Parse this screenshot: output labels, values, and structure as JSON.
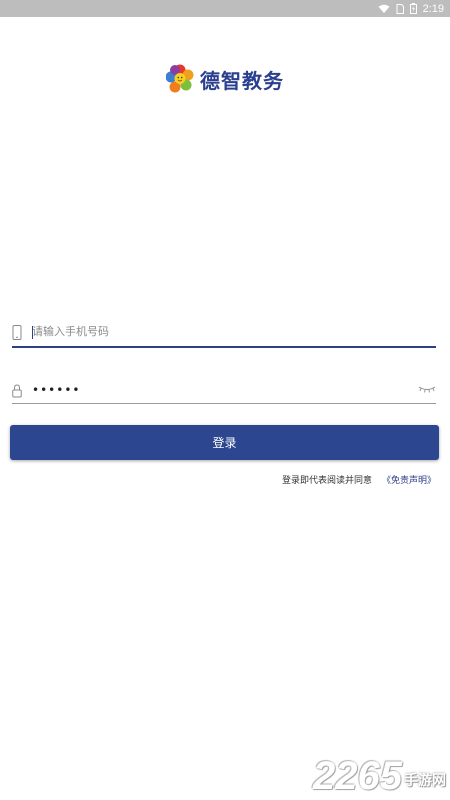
{
  "status_bar": {
    "time": "2:19"
  },
  "app": {
    "logo_text": "德智教务"
  },
  "form": {
    "phone_placeholder": "请输入手机号码",
    "password_value": "••••••",
    "login_label": "登录"
  },
  "agreement": {
    "prefix": "登录即代表阅读并同意",
    "link": "《免责声明》"
  },
  "watermark": {
    "number": "2265",
    "text": "手游网"
  }
}
